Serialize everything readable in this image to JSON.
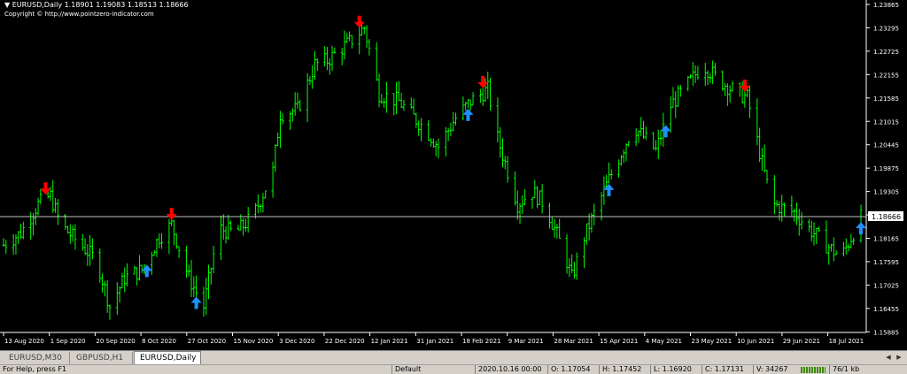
{
  "header": {
    "symbol_line": "EURUSD,Daily  1.18901 1.19083 1.18513 1.18666",
    "copyright": "Copyright © http://www.pointzero-indicator.com"
  },
  "chart_data": {
    "type": "line",
    "style": "bars",
    "title": "EURUSD,Daily",
    "ohlc": {
      "open": 1.18901,
      "high": 1.19083,
      "low": 1.18513,
      "close": 1.18666
    },
    "current_price": "1.18666",
    "ylim": [
      1.1587,
      1.2393
    ],
    "y_ticks": [
      "1.23865",
      "1.23295",
      "1.22725",
      "1.22155",
      "1.21585",
      "1.21015",
      "1.20445",
      "1.19875",
      "1.19305",
      "1.18735",
      "1.18165",
      "1.17595",
      "1.17025",
      "1.16455",
      "1.15885"
    ],
    "x_ticks": [
      "13 Aug 2020",
      "1 Sep 2020",
      "20 Sep 2020",
      "8 Oct 2020",
      "27 Oct 2020",
      "15 Nov 2020",
      "3 Dec 2020",
      "22 Dec 2020",
      "12 Jan 2021",
      "31 Jan 2021",
      "18 Feb 2021",
      "9 Mar 2021",
      "28 Mar 2021",
      "15 Apr 2021",
      "4 May 2021",
      "23 May 2021",
      "10 Jun 2021",
      "29 Jun 2021",
      "18 Jul 2021"
    ],
    "series": [
      {
        "values": [
          {
            "date": "2020-08-13",
            "price": 1.18
          },
          {
            "date": "2020-08-20",
            "price": 1.183
          },
          {
            "date": "2020-08-27",
            "price": 1.19
          },
          {
            "date": "2020-09-01",
            "price": 1.192
          },
          {
            "date": "2020-09-05",
            "price": 1.185
          },
          {
            "date": "2020-09-10",
            "price": 1.182
          },
          {
            "date": "2020-09-20",
            "price": 1.176
          },
          {
            "date": "2020-09-25",
            "price": 1.165
          },
          {
            "date": "2020-10-01",
            "price": 1.172
          },
          {
            "date": "2020-10-08",
            "price": 1.174
          },
          {
            "date": "2020-10-15",
            "price": 1.182
          },
          {
            "date": "2020-10-20",
            "price": 1.185
          },
          {
            "date": "2020-10-27",
            "price": 1.172
          },
          {
            "date": "2020-11-02",
            "price": 1.165
          },
          {
            "date": "2020-11-08",
            "price": 1.184
          },
          {
            "date": "2020-11-15",
            "price": 1.183
          },
          {
            "date": "2020-11-22",
            "price": 1.187
          },
          {
            "date": "2020-11-30",
            "price": 1.198
          },
          {
            "date": "2020-12-03",
            "price": 1.212
          },
          {
            "date": "2020-12-10",
            "price": 1.213
          },
          {
            "date": "2020-12-17",
            "price": 1.224
          },
          {
            "date": "2020-12-22",
            "price": 1.225
          },
          {
            "date": "2021-01-01",
            "price": 1.23
          },
          {
            "date": "2021-01-06",
            "price": 1.233
          },
          {
            "date": "2021-01-12",
            "price": 1.217
          },
          {
            "date": "2021-01-20",
            "price": 1.215
          },
          {
            "date": "2021-01-31",
            "price": 1.208
          },
          {
            "date": "2021-02-05",
            "price": 1.204
          },
          {
            "date": "2021-02-12",
            "price": 1.211
          },
          {
            "date": "2021-02-18",
            "price": 1.215
          },
          {
            "date": "2021-02-25",
            "price": 1.218
          },
          {
            "date": "2021-03-01",
            "price": 1.206
          },
          {
            "date": "2021-03-09",
            "price": 1.19
          },
          {
            "date": "2021-03-15",
            "price": 1.193
          },
          {
            "date": "2021-03-20",
            "price": 1.19
          },
          {
            "date": "2021-03-28",
            "price": 1.178
          },
          {
            "date": "2021-03-31",
            "price": 1.172
          },
          {
            "date": "2021-04-05",
            "price": 1.182
          },
          {
            "date": "2021-04-15",
            "price": 1.196
          },
          {
            "date": "2021-04-25",
            "price": 1.209
          },
          {
            "date": "2021-05-04",
            "price": 1.203
          },
          {
            "date": "2021-05-10",
            "price": 1.214
          },
          {
            "date": "2021-05-18",
            "price": 1.22
          },
          {
            "date": "2021-05-23",
            "price": 1.224
          },
          {
            "date": "2021-05-30",
            "price": 1.22
          },
          {
            "date": "2021-06-06",
            "price": 1.217
          },
          {
            "date": "2021-06-10",
            "price": 1.216
          },
          {
            "date": "2021-06-16",
            "price": 1.2
          },
          {
            "date": "2021-06-20",
            "price": 1.19
          },
          {
            "date": "2021-06-29",
            "price": 1.188
          },
          {
            "date": "2021-07-05",
            "price": 1.184
          },
          {
            "date": "2021-07-12",
            "price": 1.18
          },
          {
            "date": "2021-07-18",
            "price": 1.177
          },
          {
            "date": "2021-07-26",
            "price": 1.1867
          }
        ]
      }
    ],
    "signals": [
      {
        "date": "2020-08-30",
        "type": "sell"
      },
      {
        "date": "2020-10-10",
        "type": "buy"
      },
      {
        "date": "2020-10-20",
        "type": "sell"
      },
      {
        "date": "2020-10-30",
        "type": "buy"
      },
      {
        "date": "2021-01-04",
        "type": "sell"
      },
      {
        "date": "2021-02-17",
        "type": "buy"
      },
      {
        "date": "2021-02-23",
        "type": "sell"
      },
      {
        "date": "2021-04-15",
        "type": "buy"
      },
      {
        "date": "2021-05-08",
        "type": "buy"
      },
      {
        "date": "2021-06-09",
        "type": "sell"
      },
      {
        "date": "2021-07-26",
        "type": "buy"
      }
    ],
    "colors": {
      "bars": "#00ff00",
      "background": "#000000",
      "axis": "#ffffff",
      "buy": "#1e90ff",
      "sell": "#ff0000"
    }
  },
  "tabs": [
    {
      "label": "EURUSD,M30",
      "active": false
    },
    {
      "label": "GBPUSD,H1",
      "active": false
    },
    {
      "label": "EURUSD,Daily",
      "active": true
    }
  ],
  "status": {
    "help": "For Help, press F1",
    "profile": "Default",
    "time": "2020.10.16 00:00",
    "open": "O: 1.17054",
    "high": "H: 1.17452",
    "low": "L: 1.16920",
    "close": "C: 1.17131",
    "volume": "V: 34267",
    "traffic": "76/1 kb"
  }
}
